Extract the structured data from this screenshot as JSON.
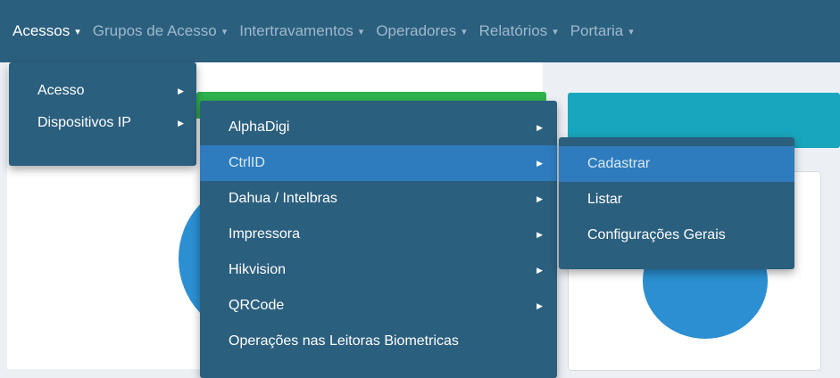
{
  "navbar": {
    "items": [
      {
        "label": "Acessos",
        "active": true
      },
      {
        "label": "Grupos de Acesso"
      },
      {
        "label": "Intertravamentos"
      },
      {
        "label": "Operadores"
      },
      {
        "label": "Relatórios"
      },
      {
        "label": "Portaria"
      }
    ],
    "caret": "▾"
  },
  "menu_level1": {
    "items": [
      {
        "label": "Acesso"
      },
      {
        "label": "Dispositivos IP"
      }
    ]
  },
  "menu_level2": {
    "items": [
      {
        "label": "AlphaDigi"
      },
      {
        "label": "CtrlID"
      },
      {
        "label": "Dahua / Intelbras"
      },
      {
        "label": "Impressora"
      },
      {
        "label": "Hikvision"
      },
      {
        "label": "QRCode"
      },
      {
        "label": "Operações nas Leitoras Biometricas"
      }
    ]
  },
  "menu_level3": {
    "items": [
      {
        "label": "Cadastrar"
      },
      {
        "label": "Listar"
      },
      {
        "label": "Configurações Gerais"
      }
    ]
  },
  "arrow_glyph": "▶",
  "colors": {
    "navbar": "#2b5f7e",
    "highlight": "#2e7cbd",
    "green": "#2eb34c",
    "teal": "#17a6bd",
    "circle": "#2b8fd1"
  }
}
